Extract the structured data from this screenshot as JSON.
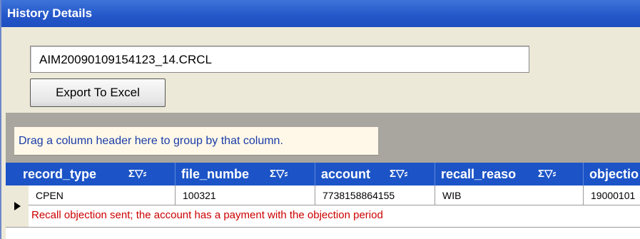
{
  "window": {
    "title": "History Details"
  },
  "file_field": {
    "value": "AIM20090109154123_14.CRCL"
  },
  "toolbar": {
    "export_label": "Export To Excel"
  },
  "grid": {
    "group_hint": "Drag a column header here to group by that column.",
    "header_icons": "Σ▽⸗",
    "columns": [
      {
        "label": "record_type"
      },
      {
        "label": "file_numbe"
      },
      {
        "label": "account"
      },
      {
        "label": "recall_reaso"
      },
      {
        "label": "objectio"
      }
    ],
    "rows": [
      {
        "cells": [
          "CPEN",
          "100321",
          "7738158864155",
          "WIB",
          "19000101"
        ]
      }
    ],
    "note": "Recall objection sent; the account has a payment with the objection period"
  },
  "colors": {
    "titlebar": "#2456c9",
    "header": "#1c54c7",
    "note_text": "#cc0000",
    "group_hint_text": "#1a3ca8"
  }
}
